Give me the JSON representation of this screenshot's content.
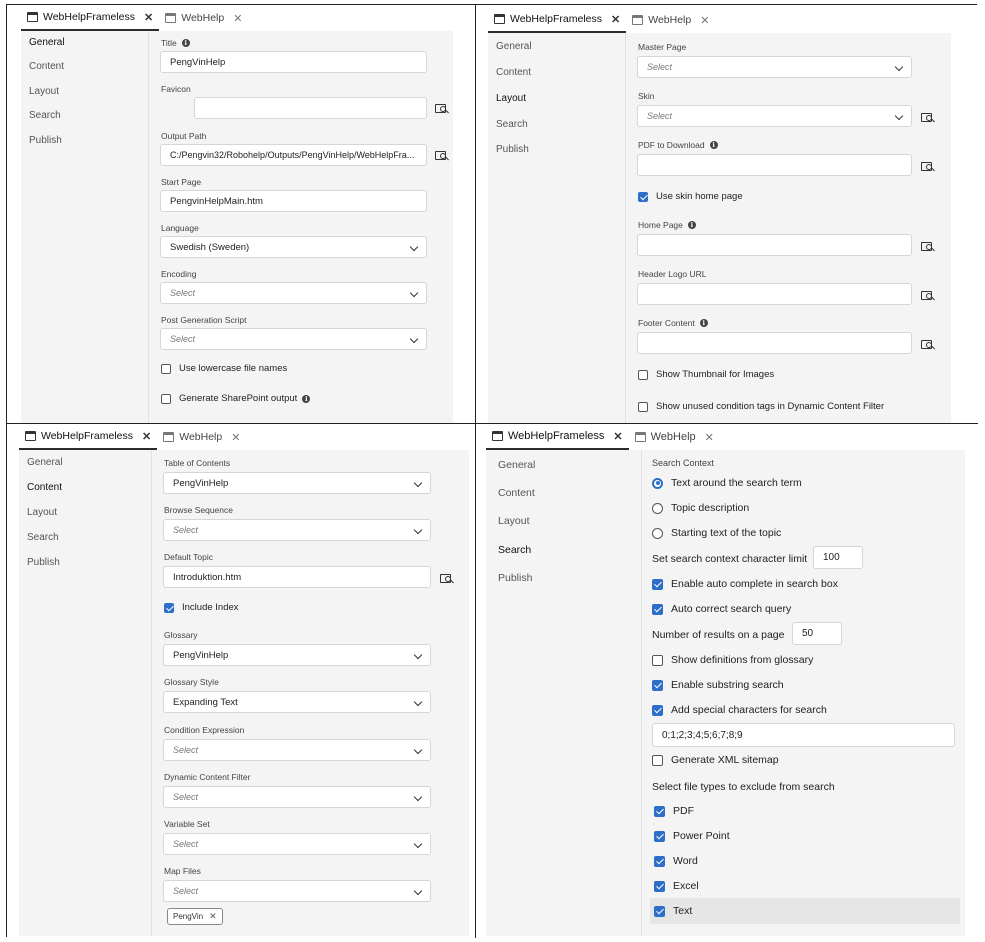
{
  "tabs": {
    "active": "WebHelpFrameless",
    "inactive": "WebHelp"
  },
  "nav": {
    "general": "General",
    "content": "Content",
    "layout": "Layout",
    "search": "Search",
    "publish": "Publish"
  },
  "general": {
    "title_label": "Title",
    "title_value": "PengVinHelp",
    "favicon_label": "Favicon",
    "favicon_value": "",
    "output_label": "Output Path",
    "output_value": "C:/Pengvin32/Robohelp/Outputs/PengVinHelp/WebHelpFra...",
    "start_label": "Start Page",
    "start_value": "PengvinHelpMain.htm",
    "language_label": "Language",
    "language_value": "Swedish (Sweden)",
    "encoding_label": "Encoding",
    "encoding_value": "Select",
    "postgen_label": "Post Generation Script",
    "postgen_value": "Select",
    "lowercase_label": "Use lowercase file names",
    "lowercase_checked": false,
    "sharepoint_label": "Generate SharePoint output",
    "sharepoint_checked": false
  },
  "layout": {
    "master_label": "Master Page",
    "master_value": "Select",
    "skin_label": "Skin",
    "skin_value": "Select",
    "pdf_label": "PDF to Download",
    "skinhome_label": "Use skin home page",
    "skinhome_checked": true,
    "home_label": "Home Page",
    "logo_label": "Header Logo URL",
    "footer_label": "Footer Content",
    "thumb_label": "Show Thumbnail for Images",
    "thumb_checked": false,
    "unused_label": "Show unused condition tags in Dynamic Content Filter",
    "unused_checked": false
  },
  "content": {
    "toc_label": "Table of Contents",
    "toc_value": "PengVinHelp",
    "browse_label": "Browse Sequence",
    "browse_value": "Select",
    "default_label": "Default Topic",
    "default_value": "Introduktion.htm",
    "index_label": "Include Index",
    "index_checked": true,
    "glossary_label": "Glossary",
    "glossary_value": "PengVinHelp",
    "gstyle_label": "Glossary Style",
    "gstyle_value": "Expanding Text",
    "cond_label": "Condition Expression",
    "cond_value": "Select",
    "dcf_label": "Dynamic Content Filter",
    "dcf_value": "Select",
    "varset_label": "Variable Set",
    "varset_value": "Select",
    "map_label": "Map Files",
    "map_value": "Select",
    "map_tag": "PengVin"
  },
  "search": {
    "context_label": "Search Context",
    "radio_around": "Text around the search term",
    "radio_topic": "Topic description",
    "radio_start": "Starting text of the topic",
    "limit_label": "Set search context character limit",
    "limit_value": "100",
    "auto_complete": "Enable auto complete in search box",
    "auto_correct": "Auto correct search query",
    "results_label": "Number of results on a page",
    "results_value": "50",
    "definitions": "Show definitions from glossary",
    "substring": "Enable substring search",
    "special": "Add special characters for search",
    "special_value": "0;1;2;3;4;5;6;7;8;9",
    "xml": "Generate XML sitemap",
    "exclude_label": "Select file types to exclude from search",
    "pdf": "PDF",
    "ppt": "Power Point",
    "word": "Word",
    "excel": "Excel",
    "text": "Text"
  }
}
